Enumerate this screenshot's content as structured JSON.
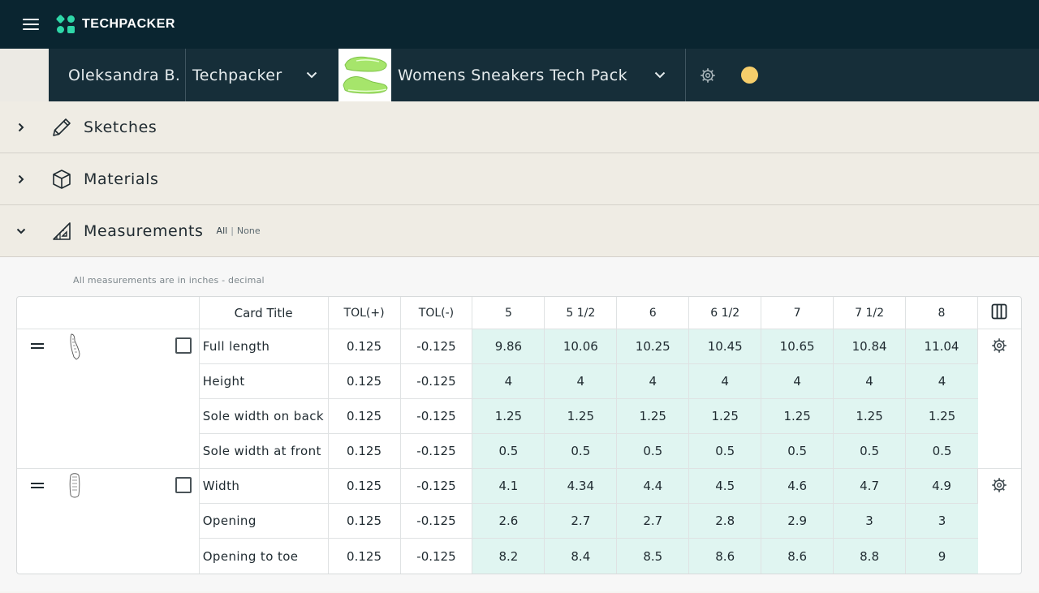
{
  "header": {
    "brand": "TECHPACKER"
  },
  "context": {
    "user": "Oleksandra B.",
    "organization": "Techpacker",
    "product": "Womens Sneakers Tech Pack",
    "status_color": "#f6ce6b",
    "product_thumb_color": "#a6e56b"
  },
  "sections": {
    "sketches": {
      "title": "Sketches",
      "icon": "pencil-icon"
    },
    "materials": {
      "title": "Materials",
      "icon": "cube-icon"
    },
    "measurements": {
      "title": "Measurements",
      "icon": "ruler-triangle-icon",
      "all": "All",
      "sep": "|",
      "none": "None"
    }
  },
  "measurements": {
    "note": "All measurements are in inches - decimal",
    "columns": {
      "title": "Card Title",
      "tol_plus": "TOL(+)",
      "tol_minus": "TOL(-)"
    },
    "sizes": [
      "5",
      "5 1/2",
      "6",
      "6 1/2",
      "7",
      "7 1/2",
      "8"
    ],
    "groups": [
      {
        "rows": [
          {
            "name": "Full length",
            "tol_plus": "0.125",
            "tol_minus": "-0.125",
            "values": [
              "9.86",
              "10.06",
              "10.25",
              "10.45",
              "10.65",
              "10.84",
              "11.04"
            ]
          },
          {
            "name": "Height",
            "tol_plus": "0.125",
            "tol_minus": "-0.125",
            "values": [
              "4",
              "4",
              "4",
              "4",
              "4",
              "4",
              "4"
            ]
          },
          {
            "name": "Sole width on back",
            "tol_plus": "0.125",
            "tol_minus": "-0.125",
            "values": [
              "1.25",
              "1.25",
              "1.25",
              "1.25",
              "1.25",
              "1.25",
              "1.25"
            ]
          },
          {
            "name": "Sole width at front",
            "tol_plus": "0.125",
            "tol_minus": "-0.125",
            "values": [
              "0.5",
              "0.5",
              "0.5",
              "0.5",
              "0.5",
              "0.5",
              "0.5"
            ]
          }
        ]
      },
      {
        "rows": [
          {
            "name": "Width",
            "tol_plus": "0.125",
            "tol_minus": "-0.125",
            "values": [
              "4.1",
              "4.34",
              "4.4",
              "4.5",
              "4.6",
              "4.7",
              "4.9"
            ]
          },
          {
            "name": "Opening",
            "tol_plus": "0.125",
            "tol_minus": "-0.125",
            "values": [
              "2.6",
              "2.7",
              "2.7",
              "2.8",
              "2.9",
              "3",
              "3"
            ]
          },
          {
            "name": "Opening to toe",
            "tol_plus": "0.125",
            "tol_minus": "-0.125",
            "values": [
              "8.2",
              "8.4",
              "8.5",
              "8.6",
              "8.6",
              "8.8",
              "9"
            ]
          }
        ]
      }
    ]
  }
}
